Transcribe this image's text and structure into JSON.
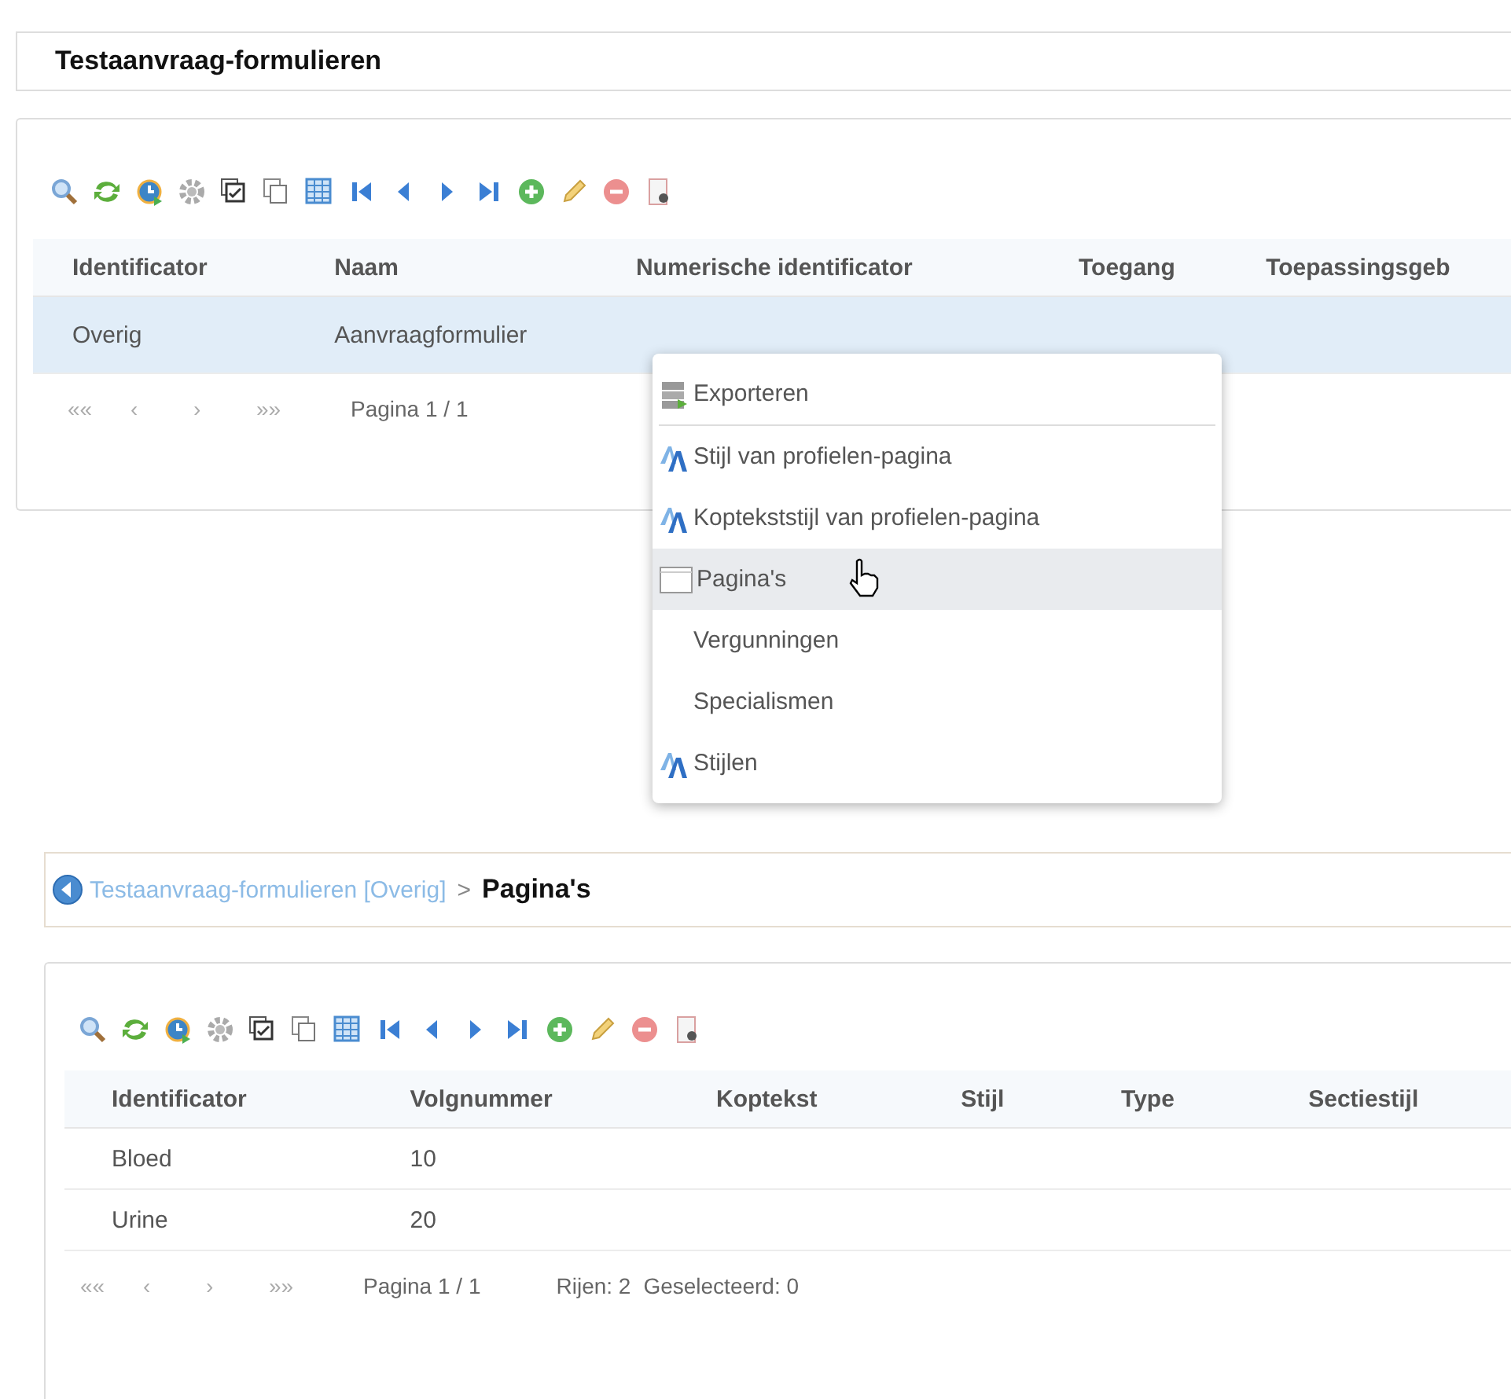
{
  "header": {
    "title": "Testaanvraag-formulieren"
  },
  "forms_table": {
    "columns": [
      "Identificator",
      "Naam",
      "Numerische identificator",
      "Toegang",
      "Toepassingsgeb"
    ],
    "rows": [
      {
        "cells": [
          "Overig",
          "Aanvraagformulier",
          "",
          ""
        ],
        "selected": true
      }
    ],
    "pager": {
      "first": "««",
      "prev": "‹",
      "next": "›",
      "last": "»»",
      "page": "Pagina 1 / 1"
    }
  },
  "context_menu": {
    "items": [
      {
        "label": "Exporteren",
        "kind": "export",
        "selected": false
      },
      {
        "label": "Stijl van profielen-pagina",
        "kind": "style",
        "selected": false
      },
      {
        "label": "Koptekststijl van profielen-pagina",
        "kind": "style",
        "selected": false
      },
      {
        "label": "Pagina's",
        "kind": "page",
        "selected": true
      },
      {
        "label": "Vergunningen",
        "kind": "plain",
        "selected": false
      },
      {
        "label": "Specialismen",
        "kind": "plain",
        "selected": false
      },
      {
        "label": "Stijlen",
        "kind": "style",
        "selected": false
      }
    ]
  },
  "breadcrumb": {
    "link": "Testaanvraag-formulieren [Overig]",
    "separator": ">",
    "current": "Pagina's"
  },
  "pages_table": {
    "columns": [
      "Identificator",
      "Volgnummer",
      "Koptekst",
      "Stijl",
      "Type",
      "Sectiestijl"
    ],
    "rows": [
      {
        "cells": [
          "Bloed",
          "10"
        ],
        "selected": false
      },
      {
        "cells": [
          "Urine",
          "20"
        ],
        "selected": false
      }
    ],
    "pager": {
      "first": "««",
      "prev": "‹",
      "next": "›",
      "last": "»»",
      "page": "Pagina 1 / 1",
      "rows": "Rijen: 2",
      "selected_count": "Geselecteerd: 0"
    }
  }
}
